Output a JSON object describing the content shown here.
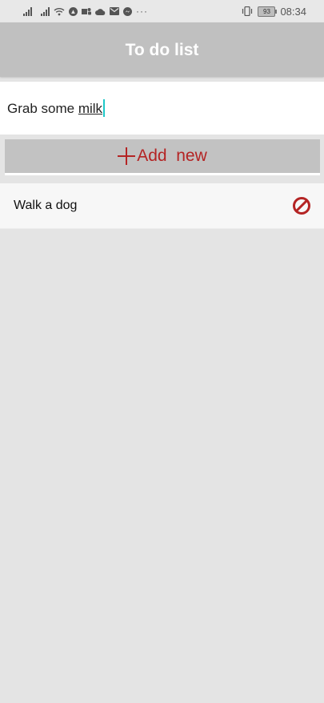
{
  "status_bar": {
    "icons": [
      "signal-icon",
      "signal-icon",
      "wifi-icon",
      "navigation-icon",
      "teams-icon",
      "cloud-icon",
      "mail-icon",
      "messenger-icon",
      "more-dots-icon",
      "vibrate-icon",
      "battery-icon"
    ],
    "more": "···",
    "battery": "93",
    "time": "08:34"
  },
  "header": {
    "title": "To do list"
  },
  "input": {
    "prefix": "Grab some ",
    "underlined": "milk"
  },
  "add_button": {
    "label": "Add  new",
    "icon": "plus-icon",
    "color": "#b42424"
  },
  "todos": [
    {
      "label": "Walk a dog",
      "action_icon": "delete-icon"
    }
  ],
  "colors": {
    "header": "#c0c0c0",
    "accent": "#b42424",
    "background": "#e4e4e4",
    "caret": "#1ec8c8"
  }
}
